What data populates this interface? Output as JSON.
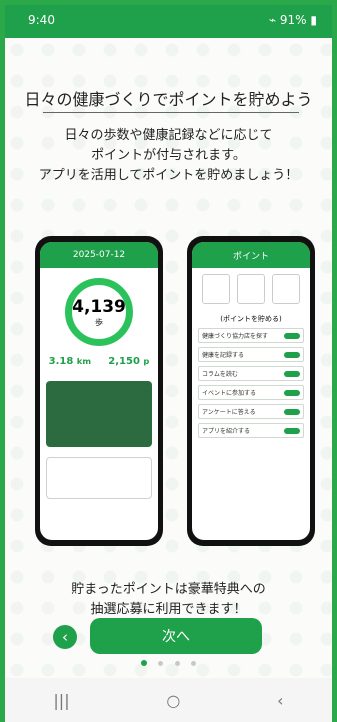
{
  "status_bar": {
    "time": "9:40",
    "battery_text": "91%"
  },
  "onboarding": {
    "title": "日々の健康づくりでポイントを貯めよう",
    "desc_lines": [
      "日々の歩数や健康記録などに応じて",
      "ポイントが付与されます。",
      "アプリを活用してポイントを貯めましょう！"
    ],
    "caption_lines": [
      "貯まったポイントは豪華特典への",
      "抽選応募に利用できます！"
    ],
    "next_label": "次へ"
  },
  "left_phone": {
    "date": "2025-07-12",
    "steps": "4,139",
    "steps_unit": "歩",
    "distance": "3.18",
    "distance_unit": "km",
    "points": "2,150",
    "points_unit": "p"
  },
  "right_phone": {
    "header": "ポイント",
    "subhead": "(ポイントを貯める)",
    "menu": [
      "健康づくり協力店を探す",
      "健康を記録する",
      "コラムを読む",
      "イベントに参加する",
      "アンケートに答える",
      "アプリを紹介する"
    ]
  },
  "colors": {
    "accent": "#1fa04a"
  },
  "pagination": {
    "total": 4,
    "active_index": 0
  }
}
